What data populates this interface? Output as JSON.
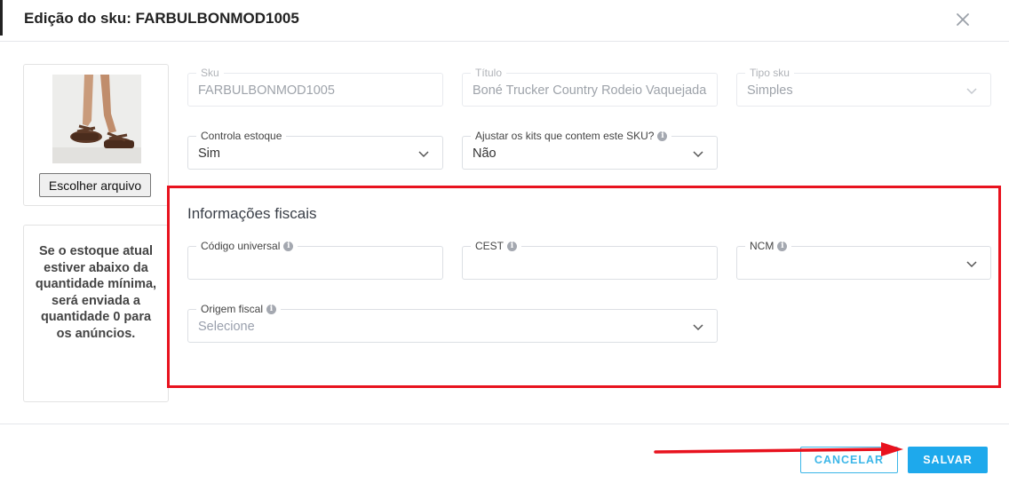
{
  "modal": {
    "title": "Edição do sku: FARBULBONMOD1005",
    "close_icon": "close-icon"
  },
  "image_card": {
    "file_button_label": "Escolher arquivo",
    "thumbnail": "product-photo-sandals"
  },
  "info_card": {
    "text": "Se o estoque atual estiver abaixo da quantidade mínima, será enviada a quantidade 0 para os anúncios."
  },
  "fields": {
    "sku": {
      "label": "Sku",
      "value": "FARBULBONMOD1005"
    },
    "titulo": {
      "label": "Título",
      "value": "Boné Trucker Country Rodeio Vaquejada"
    },
    "tipo_sku": {
      "label": "Tipo sku",
      "value": "Simples"
    },
    "controla_estoque": {
      "label": "Controla estoque",
      "value": "Sim"
    },
    "ajustar_kits": {
      "label": "Ajustar os kits que contem este SKU?",
      "value": "Não"
    }
  },
  "fiscal": {
    "section_title": "Informações fiscais",
    "codigo_universal": {
      "label": "Código universal",
      "value": ""
    },
    "cest": {
      "label": "CEST",
      "value": ""
    },
    "ncm": {
      "label": "NCM",
      "value": ""
    },
    "origem_fiscal": {
      "label": "Origem fiscal",
      "placeholder": "Selecione"
    }
  },
  "footer": {
    "cancel_label": "CANCELAR",
    "save_label": "SALVAR"
  },
  "colors": {
    "highlight": "#e8121e",
    "primary": "#1ea9ec",
    "outline": "#3bb6e8"
  }
}
